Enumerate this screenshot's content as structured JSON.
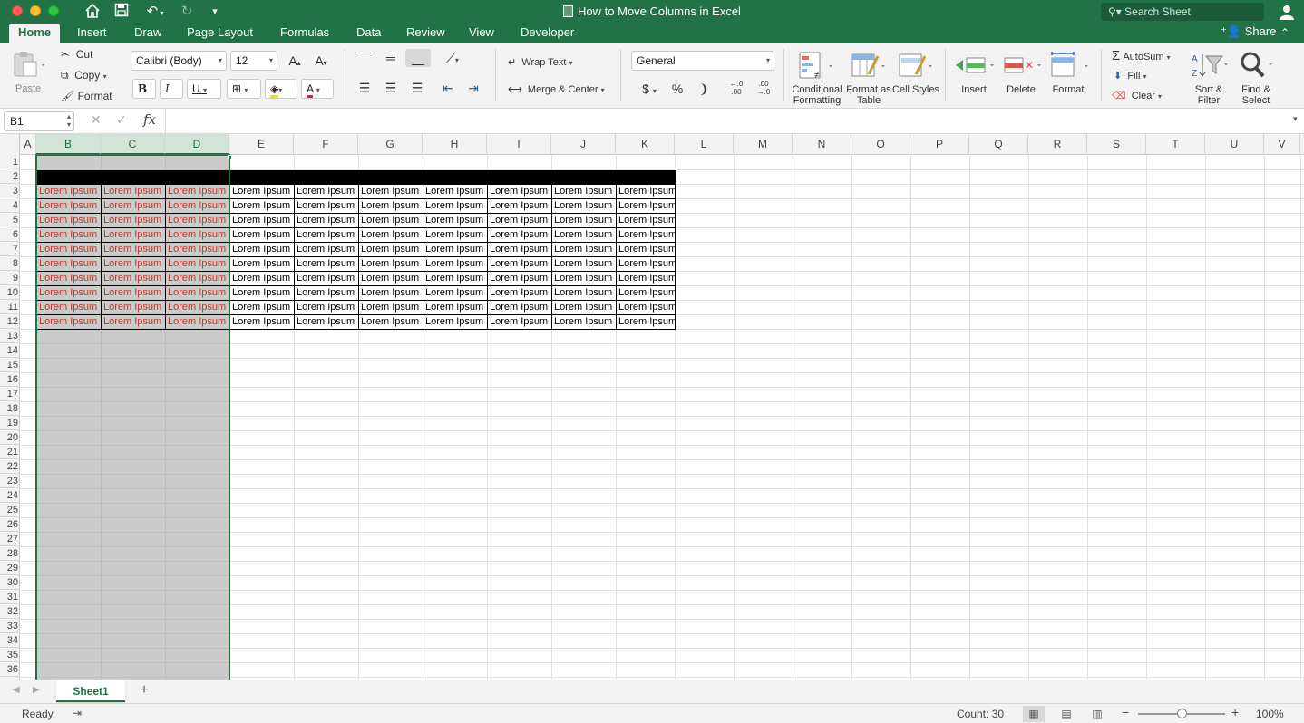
{
  "window": {
    "title": "How to Move Columns in Excel",
    "search_placeholder": "Search Sheet"
  },
  "quick_access": [
    "home-icon",
    "save-icon",
    "undo-icon",
    "redo-icon",
    "customize-icon"
  ],
  "tabs": [
    {
      "label": "Home",
      "active": true
    },
    {
      "label": "Insert"
    },
    {
      "label": "Draw"
    },
    {
      "label": "Page Layout"
    },
    {
      "label": "Formulas"
    },
    {
      "label": "Data"
    },
    {
      "label": "Review"
    },
    {
      "label": "View"
    },
    {
      "label": "Developer"
    }
  ],
  "share_label": "Share",
  "ribbon": {
    "paste": "Paste",
    "cut": "Cut",
    "copy": "Copy",
    "format": "Format",
    "font_name": "Calibri (Body)",
    "font_size": "12",
    "wrap_text": "Wrap Text",
    "merge_center": "Merge & Center",
    "number_format": "General",
    "conditional_formatting": "Conditional Formatting",
    "format_as_table": "Format as Table",
    "cell_styles": "Cell Styles",
    "insert": "Insert",
    "delete": "Delete",
    "format_cells": "Format",
    "autosum": "AutoSum",
    "fill": "Fill",
    "clear": "Clear",
    "sort_filter": "Sort & Filter",
    "find_select": "Find & Select"
  },
  "formula_bar": {
    "name_box": "B1",
    "formula": ""
  },
  "columns": [
    "A",
    "B",
    "C",
    "D",
    "E",
    "F",
    "G",
    "H",
    "I",
    "J",
    "K",
    "L",
    "M",
    "N",
    "O",
    "P",
    "Q",
    "R",
    "S",
    "T",
    "U",
    "V"
  ],
  "selected_columns": [
    "B",
    "C",
    "D"
  ],
  "rows": [
    "1",
    "2",
    "3",
    "4",
    "5",
    "6",
    "7",
    "8",
    "9",
    "10",
    "11",
    "12",
    "13",
    "14",
    "15",
    "16",
    "17",
    "18",
    "19",
    "20",
    "21",
    "22",
    "23",
    "24",
    "25",
    "26",
    "27",
    "28",
    "29",
    "30",
    "31",
    "32",
    "33",
    "34",
    "35",
    "36"
  ],
  "cell_text": "Lorem Ipsum",
  "data_rows": 10,
  "data_columns": [
    "B",
    "C",
    "D",
    "E",
    "F",
    "G",
    "H",
    "I",
    "J",
    "K"
  ],
  "highlight_text_color": "#c0392b",
  "accent_color": "#217346",
  "sheets": [
    {
      "name": "Sheet1",
      "active": true
    }
  ],
  "status": {
    "ready": "Ready",
    "count": "Count: 30",
    "zoom": "100%"
  }
}
